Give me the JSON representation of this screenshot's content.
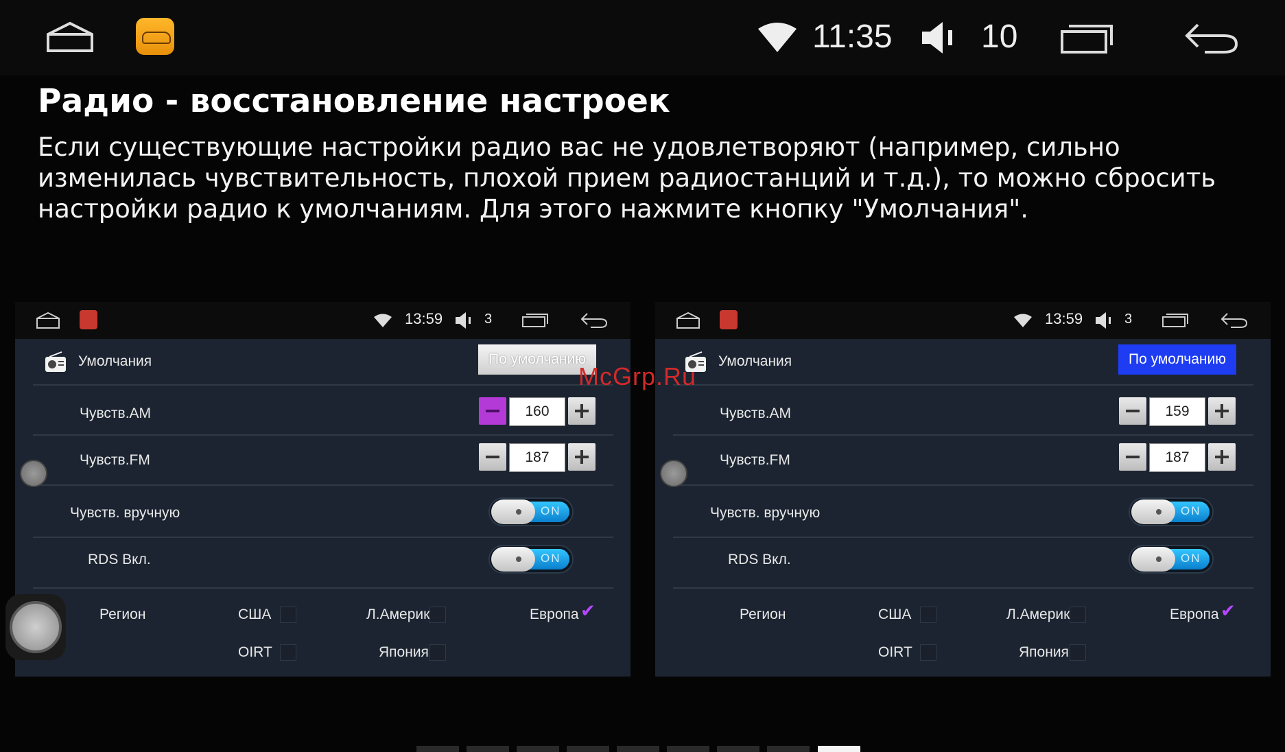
{
  "statusbar": {
    "time": "11:35",
    "volume": "10",
    "icons": [
      "home-icon",
      "app-icon",
      "wifi-icon",
      "volume-icon",
      "recents-icon",
      "back-icon"
    ]
  },
  "heading": {
    "title": "Радио - восстановление настроек",
    "description": "Если существующие настройки радио вас не удовлетворяют (например, сильно изменилась чувствительность, плохой прием радиостанций и т.д.), то можно сбросить настройки радио к умолчаниям. Для этого нажмите кнопку \"Умолчания\"."
  },
  "watermark": "McGrp.Ru",
  "panels": [
    {
      "bar": {
        "time": "13:59",
        "volume": "3"
      },
      "defaults_label": "Умолчания",
      "defaults_button": "По умолчанию",
      "am_label": "Чувств.AM",
      "am_value": "160",
      "fm_label": "Чувств.FM",
      "fm_value": "187",
      "manual_label": "Чувств. вручную",
      "manual_toggle": "ON",
      "rds_label": "RDS Вкл.",
      "rds_toggle": "ON",
      "region_label": "Регион",
      "regions": [
        "США",
        "Л.Америка",
        "Европа",
        "OIRT",
        "Япония"
      ]
    },
    {
      "bar": {
        "time": "13:59",
        "volume": "3"
      },
      "defaults_label": "Умолчания",
      "defaults_button": "По умолчанию",
      "am_label": "Чувств.AM",
      "am_value": "159",
      "fm_label": "Чувств.FM",
      "fm_value": "187",
      "manual_label": "Чувств. вручную",
      "manual_toggle": "ON",
      "rds_label": "RDS Вкл.",
      "rds_toggle": "ON",
      "region_label": "Регион",
      "regions": [
        "США",
        "Л.Америка",
        "Европа",
        "OIRT",
        "Япония"
      ]
    }
  ],
  "colors": {
    "accent_blue": "#1e3cf2",
    "accent_purple": "#b43ad8",
    "panel_bg": "#1c2431",
    "watermark": "#d12a2a"
  },
  "pager": {
    "pages": 9,
    "current": 9
  }
}
